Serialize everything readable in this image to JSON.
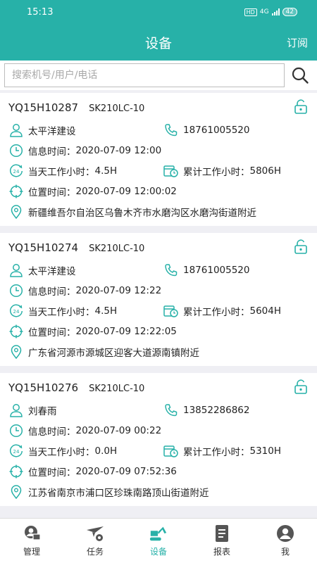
{
  "status": {
    "time": "15:13",
    "hd": "HD",
    "net": "4G",
    "battery": "42"
  },
  "header": {
    "title": "设备",
    "subscribe": "订阅"
  },
  "search": {
    "placeholder": "搜索机号/用户/电话",
    "value": ""
  },
  "labels": {
    "info_time": "信息时间：",
    "today_hours": "当天工作小时：",
    "total_hours": "累计工作小时：",
    "position_time": "位置时间："
  },
  "devices": [
    {
      "machine_no": "YQ15H10287",
      "model": "SK210LC-10",
      "owner": "太平洋建设",
      "phone": "18761005520",
      "info_time": "2020-07-09 12:00",
      "today_hours": "4.5H",
      "total_hours": "5806H",
      "position_time": "2020-07-09 12:00:02",
      "address": "新疆维吾尔自治区乌鲁木齐市水磨沟区水磨沟街道附近"
    },
    {
      "machine_no": "YQ15H10274",
      "model": "SK210LC-10",
      "owner": "太平洋建设",
      "phone": "18761005520",
      "info_time": "2020-07-09 12:22",
      "today_hours": "4.5H",
      "total_hours": "5604H",
      "position_time": "2020-07-09 12:22:05",
      "address": "广东省河源市源城区迎客大道源南镇附近"
    },
    {
      "machine_no": "YQ15H10276",
      "model": "SK210LC-10",
      "owner": "刘春雨",
      "phone": "13852286862",
      "info_time": "2020-07-09 00:22",
      "today_hours": "0.0H",
      "total_hours": "5310H",
      "position_time": "2020-07-09 07:52:36",
      "address": "江苏省南京市浦口区珍珠南路顶山街道附近"
    }
  ],
  "tabs": [
    {
      "label": "管理",
      "icon": "manage-icon"
    },
    {
      "label": "任务",
      "icon": "task-icon"
    },
    {
      "label": "设备",
      "icon": "excavator-icon",
      "active": true
    },
    {
      "label": "报表",
      "icon": "report-icon"
    },
    {
      "label": "我",
      "icon": "profile-icon"
    }
  ],
  "colors": {
    "accent": "#27b1a8",
    "icon": "#27b1a8",
    "background": "#efeff4"
  }
}
